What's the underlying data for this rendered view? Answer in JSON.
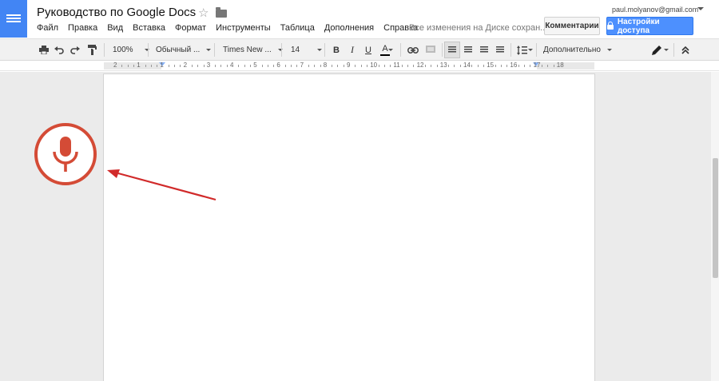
{
  "header": {
    "title": "Руководство по Google Docs",
    "menu": [
      "Файл",
      "Правка",
      "Вид",
      "Вставка",
      "Формат",
      "Инструменты",
      "Таблица",
      "Дополнения",
      "Справка"
    ],
    "save_status": "Все изменения на Диске сохран...",
    "account_email": "paul.molyanov@gmail.com",
    "comments_label": "Комментарии",
    "share_label": "Настройки доступа"
  },
  "toolbar": {
    "zoom": "100%",
    "style": "Обычный ...",
    "font": "Times New ...",
    "size": "14",
    "bold": "B",
    "italic": "I",
    "underline": "U",
    "text_color": "A",
    "more_label": "Дополнительно"
  },
  "ruler": {
    "numbers": [
      "2",
      "1",
      "1",
      "2",
      "3",
      "4",
      "5",
      "6",
      "7",
      "8",
      "9",
      "10",
      "11",
      "12",
      "13",
      "14",
      "15",
      "16",
      "17",
      "18"
    ]
  },
  "colors": {
    "docs_blue": "#4285f4",
    "share_blue": "#4d90fe",
    "mic_red": "#d44b36",
    "arrow_red": "#d12a2a"
  },
  "icons": {
    "logo": "docs-menu-icon",
    "star": "star-icon",
    "folder": "folder-icon",
    "print": "print-icon",
    "undo": "undo-icon",
    "redo": "redo-icon",
    "paint_format": "paint-format-icon",
    "link": "link-icon",
    "comment": "comment-icon",
    "mic": "microphone-icon"
  }
}
